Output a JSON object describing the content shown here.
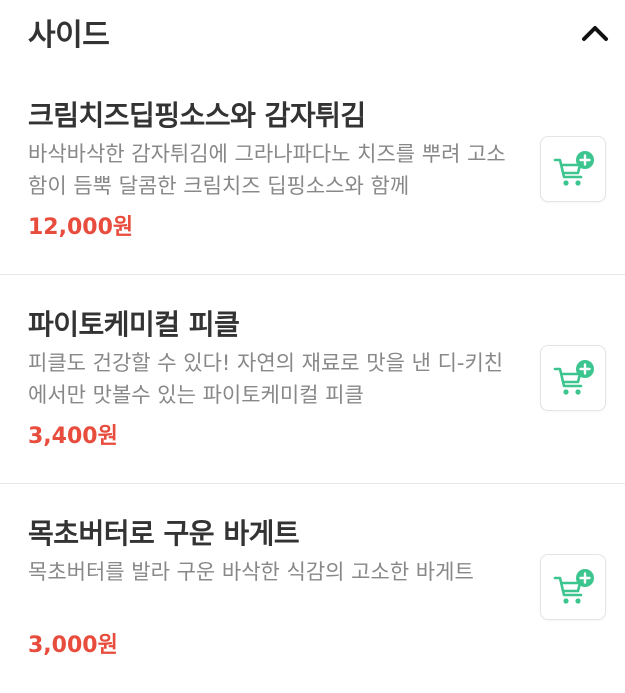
{
  "section": {
    "title": "사이드",
    "toggle_icon": "chevron-up-icon",
    "expanded": true
  },
  "colors": {
    "accent": "#3cc58f",
    "price": "#e84c3d",
    "title": "#333333",
    "description": "#888888",
    "divider": "#e6e6e6"
  },
  "items": [
    {
      "name": "크림치즈딥핑소스와 감자튀김",
      "description": "바삭바삭한 감자튀김에 그라나파다노 치즈를 뿌려 고소함이 듬뿍 달콤한 크림치즈 딥핑소스와 함께",
      "price": "12,000원",
      "cart_icon": "add-to-cart-icon"
    },
    {
      "name": "파이토케미컬 피클",
      "description": "피클도 건강할 수 있다! 자연의 재료로 맛을 낸 디-키친에서만 맛볼수 있는 파이토케미컬 피클",
      "price": "3,400원",
      "cart_icon": "add-to-cart-icon"
    },
    {
      "name": "목초버터로 구운 바게트",
      "description": "목초버터를 발라 구운 바삭한 식감의 고소한 바게트",
      "price": "3,000원",
      "cart_icon": "add-to-cart-icon"
    }
  ]
}
